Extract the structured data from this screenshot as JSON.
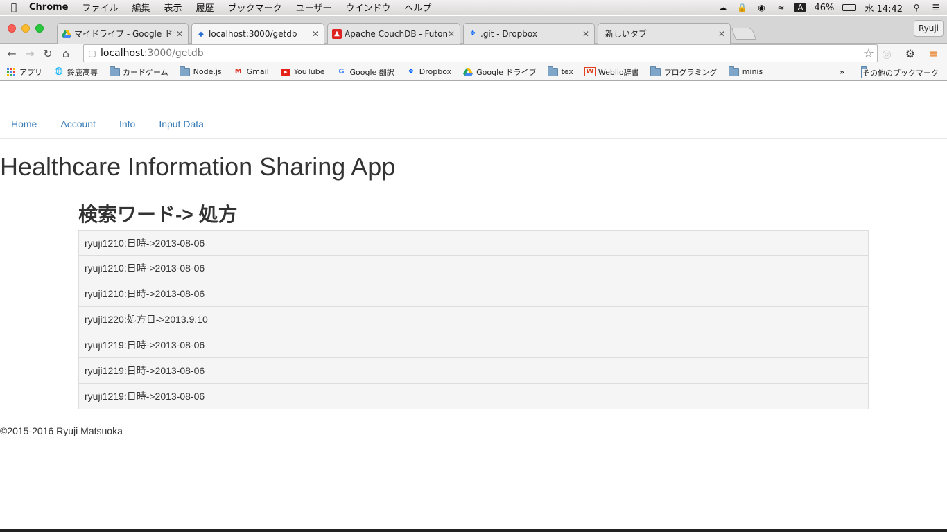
{
  "menubar": {
    "app": "Chrome",
    "items": [
      "ファイル",
      "編集",
      "表示",
      "履歴",
      "ブックマーク",
      "ユーザー",
      "ウインドウ",
      "ヘルプ"
    ],
    "battery": "46%",
    "clock": "水 14:42",
    "input_method": "A"
  },
  "tabs": [
    {
      "title": "マイドライブ - Google ドラ",
      "icon": "google-drive-icon"
    },
    {
      "title": "localhost:3000/getdb",
      "icon": "localhost-icon"
    },
    {
      "title": "Apache CouchDB - Futon:",
      "icon": "couchdb-icon"
    },
    {
      "title": ".git - Dropbox",
      "icon": "dropbox-icon"
    },
    {
      "title": "新しいタブ",
      "icon": ""
    }
  ],
  "profile": "Ryuji",
  "omnibox": {
    "host": "localhost",
    "path": ":3000/getdb"
  },
  "bookmarks": [
    {
      "label": "アプリ",
      "icon": "apps-grid-icon"
    },
    {
      "label": "鈴鹿高専",
      "icon": "site-icon"
    },
    {
      "label": "カードゲーム",
      "icon": "folder-icon"
    },
    {
      "label": "Node.js",
      "icon": "folder-icon"
    },
    {
      "label": "Gmail",
      "icon": "gmail-icon"
    },
    {
      "label": "YouTube",
      "icon": "youtube-icon"
    },
    {
      "label": "Google 翻訳",
      "icon": "google-translate-icon"
    },
    {
      "label": "Dropbox",
      "icon": "dropbox-icon"
    },
    {
      "label": "Google ドライブ",
      "icon": "google-drive-icon"
    },
    {
      "label": "tex",
      "icon": "folder-icon"
    },
    {
      "label": "Weblio辞書",
      "icon": "weblio-icon"
    },
    {
      "label": "プログラミング",
      "icon": "folder-icon"
    },
    {
      "label": "minis",
      "icon": "folder-icon"
    }
  ],
  "bookmarks_more": "»",
  "bookmarks_other": "その他のブックマーク",
  "nav": [
    "Home",
    "Account",
    "Info",
    "Input Data"
  ],
  "app_title": "Healthcare Information Sharing App",
  "subtitle": "検索ワード-> 処方",
  "results": [
    "ryuji1210:日時->2013-08-06",
    "ryuji1210:日時->2013-08-06",
    "ryuji1210:日時->2013-08-06",
    "ryuji1220:処方日->2013.9.10",
    "ryuji1219:日時->2013-08-06",
    "ryuji1219:日時->2013-08-06",
    "ryuji1219:日時->2013-08-06"
  ],
  "footer": "©2015-2016 Ryuji Matsuoka",
  "colors": {
    "link": "#337ab7",
    "list_bg": "#f5f5f5",
    "border": "#dddddd"
  }
}
